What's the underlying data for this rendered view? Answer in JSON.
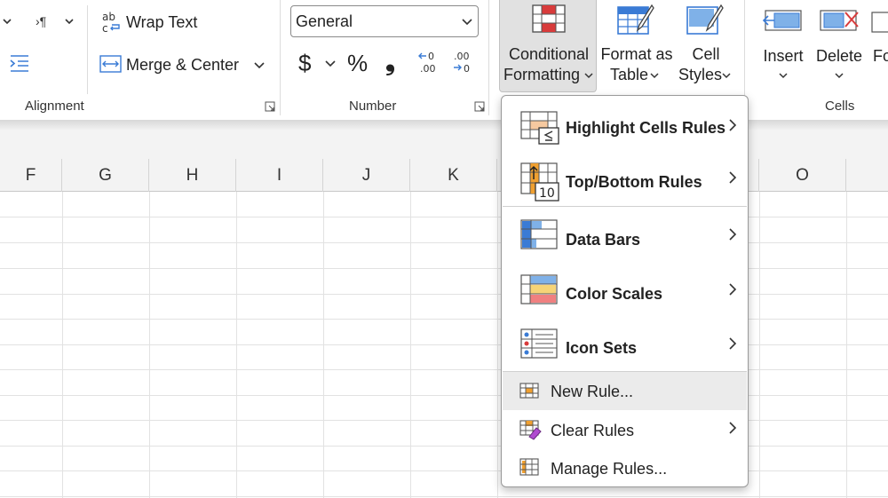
{
  "ribbon": {
    "alignment": {
      "wrap_text": "Wrap Text",
      "merge_center": "Merge & Center",
      "group_label": "Alignment"
    },
    "number": {
      "format_value": "General",
      "currency": "$",
      "percent": "%",
      "comma": "❟",
      "group_label": "Number"
    },
    "styles": {
      "conditional_formatting": [
        "Conditional",
        "Formatting"
      ],
      "format_as_table": [
        "Format as",
        "Table"
      ],
      "cell_styles": [
        "Cell",
        "Styles"
      ]
    },
    "cells": {
      "insert": "Insert",
      "delete": "Delete",
      "format_partial": "Fo",
      "group_label": "Cells"
    }
  },
  "columns": [
    "F",
    "G",
    "H",
    "I",
    "J",
    "K",
    "O"
  ],
  "menu": {
    "items": [
      {
        "label": "Highlight Cells Rules",
        "icon": "highlight-cells-icon",
        "submenu": true
      },
      {
        "label": "Top/Bottom Rules",
        "icon": "top-bottom-icon",
        "submenu": true
      },
      {
        "label": "Data Bars",
        "icon": "data-bars-icon",
        "submenu": true
      },
      {
        "label": "Color Scales",
        "icon": "color-scales-icon",
        "submenu": true
      },
      {
        "label": "Icon Sets",
        "icon": "icon-sets-icon",
        "submenu": true
      },
      {
        "label": "New Rule...",
        "icon": "new-rule-icon",
        "submenu": false
      },
      {
        "label": "Clear Rules",
        "icon": "clear-rules-icon",
        "submenu": true
      },
      {
        "label": "Manage Rules...",
        "icon": "manage-rules-icon",
        "submenu": false
      }
    ]
  },
  "colors": {
    "accent_blue": "#3a7bd5",
    "accent_red": "#d83b3b",
    "accent_orange": "#f0a030",
    "menu_hover": "#ebebeb"
  }
}
